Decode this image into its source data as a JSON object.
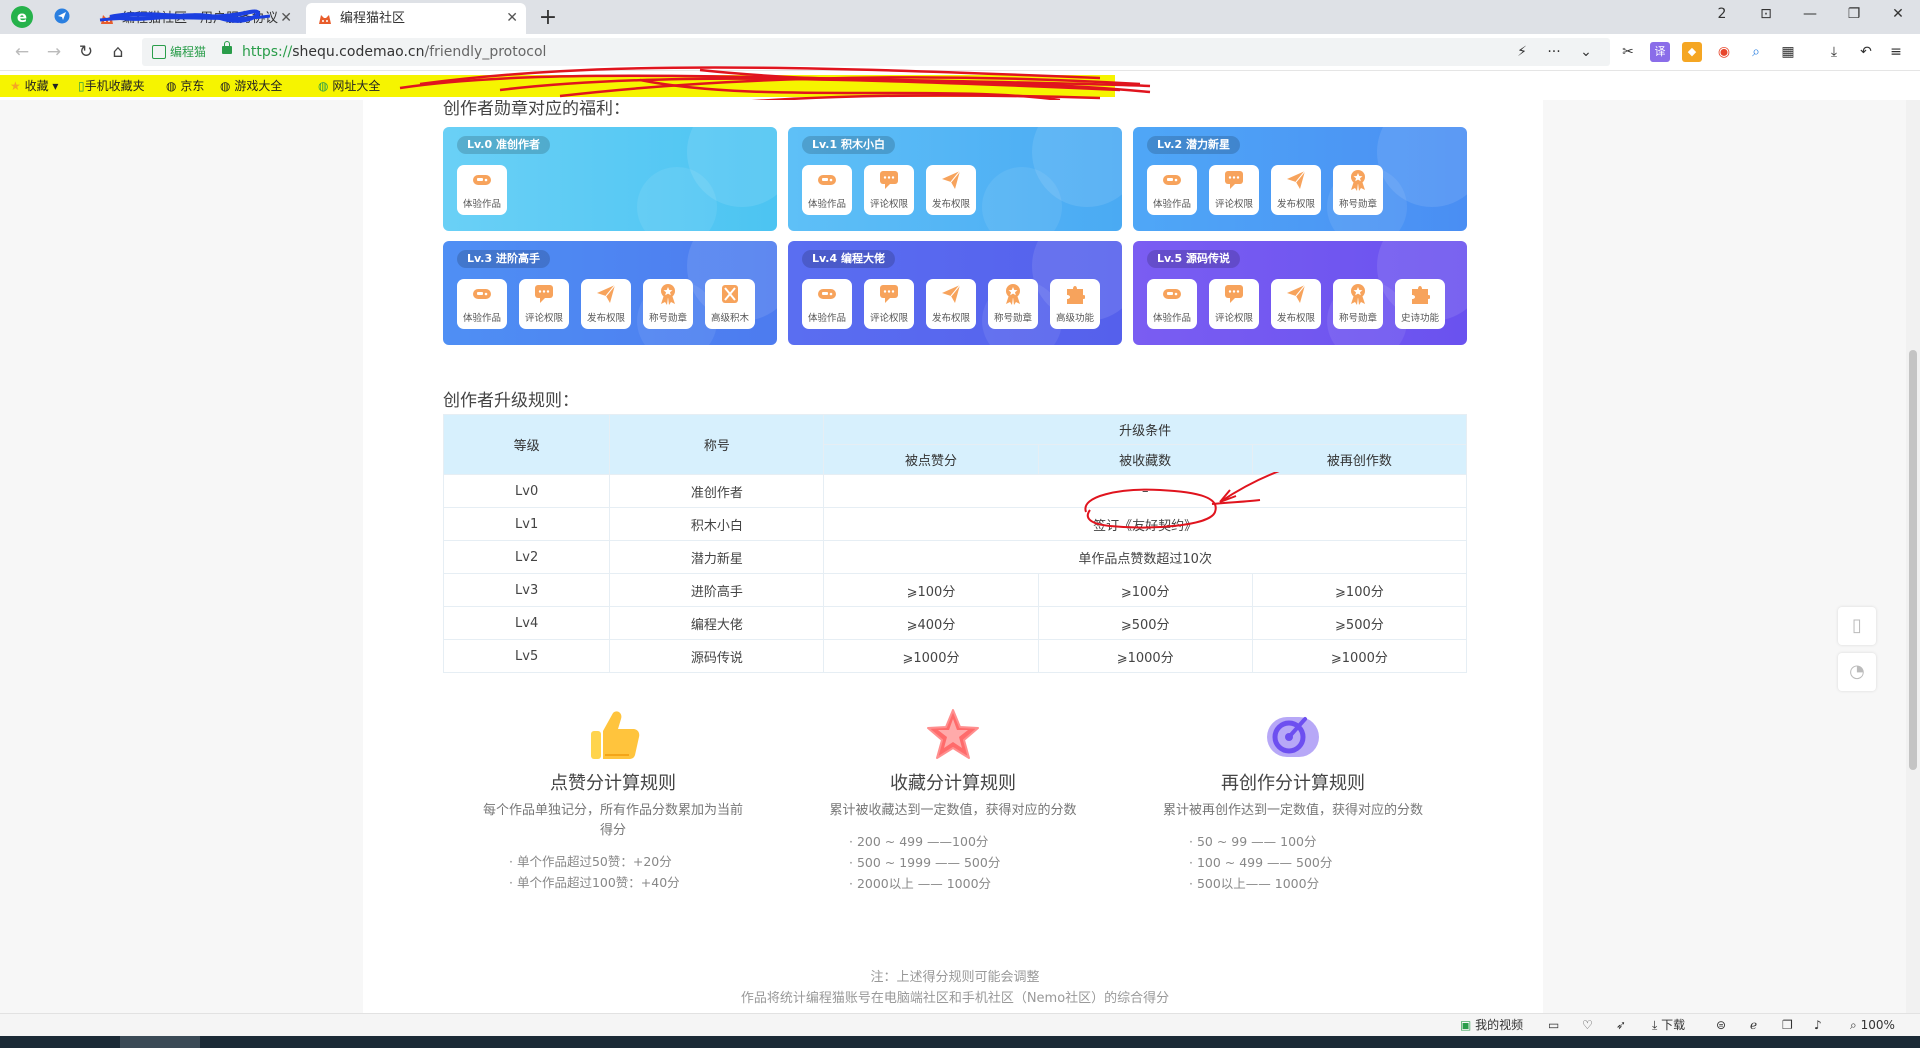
{
  "browser": {
    "tabs": [
      {
        "title": "编程猫社区 - 用户服务协议",
        "active": false
      },
      {
        "title": "编程猫社区",
        "active": true
      }
    ],
    "window_buttons": [
      "2",
      "⊡",
      "—",
      "❐",
      "✕"
    ],
    "address": {
      "site_badge": "编程猫",
      "url_protocol": "https://",
      "url_host": "shequ.codemao.cn",
      "url_path": "/friendly_protocol"
    },
    "bookmarks": [
      {
        "label": "收藏",
        "icon": "star-icon"
      },
      {
        "label": "手机收藏夹",
        "icon": "phone-icon"
      },
      {
        "label": "京东",
        "icon": "globe-icon"
      },
      {
        "label": "游戏大全",
        "icon": "globe-icon"
      },
      {
        "label": "网址大全",
        "icon": "globe-icon"
      }
    ]
  },
  "page": {
    "medal_section_title": "创作者勋章对应的福利：",
    "medal_cards": [
      {
        "level": "Lv.0",
        "name": "准创作者",
        "color_from": "#6ad0f6",
        "color_to": "#4cc4f2",
        "perms": [
          {
            "label": "体验作品",
            "icon": "gamepad-icon"
          }
        ]
      },
      {
        "level": "Lv.1",
        "name": "积木小白",
        "color_from": "#5ec0f7",
        "color_to": "#4aaaf3",
        "perms": [
          {
            "label": "体验作品",
            "icon": "gamepad-icon"
          },
          {
            "label": "评论权限",
            "icon": "comment-icon"
          },
          {
            "label": "发布权限",
            "icon": "paper-plane-icon"
          }
        ]
      },
      {
        "level": "Lv.2",
        "name": "潜力新星",
        "color_from": "#4fa7f7",
        "color_to": "#4a8ef3",
        "perms": [
          {
            "label": "体验作品",
            "icon": "gamepad-icon"
          },
          {
            "label": "评论权限",
            "icon": "comment-icon"
          },
          {
            "label": "发布权限",
            "icon": "paper-plane-icon"
          },
          {
            "label": "称号勋章",
            "icon": "medal-icon"
          }
        ]
      },
      {
        "level": "Lv.3",
        "name": "进阶高手",
        "color_from": "#4f8ff4",
        "color_to": "#4d7bef",
        "perms": [
          {
            "label": "体验作品",
            "icon": "gamepad-icon"
          },
          {
            "label": "评论权限",
            "icon": "comment-icon"
          },
          {
            "label": "发布权限",
            "icon": "paper-plane-icon"
          },
          {
            "label": "称号勋章",
            "icon": "medal-icon"
          },
          {
            "label": "高级积木",
            "icon": "tools-icon"
          }
        ]
      },
      {
        "level": "Lv.4",
        "name": "编程大佬",
        "color_from": "#5a6ef1",
        "color_to": "#5560ec",
        "perms": [
          {
            "label": "体验作品",
            "icon": "gamepad-icon"
          },
          {
            "label": "评论权限",
            "icon": "comment-icon"
          },
          {
            "label": "发布权限",
            "icon": "paper-plane-icon"
          },
          {
            "label": "称号勋章",
            "icon": "medal-icon"
          },
          {
            "label": "高级功能",
            "icon": "puzzle-icon"
          }
        ]
      },
      {
        "level": "Lv.5",
        "name": "源码传说",
        "color_from": "#7a5df2",
        "color_to": "#6a52ef",
        "perms": [
          {
            "label": "体验作品",
            "icon": "gamepad-icon"
          },
          {
            "label": "评论权限",
            "icon": "comment-icon"
          },
          {
            "label": "发布权限",
            "icon": "paper-plane-icon"
          },
          {
            "label": "称号勋章",
            "icon": "medal-icon"
          },
          {
            "label": "史诗功能",
            "icon": "puzzle-icon"
          }
        ]
      }
    ],
    "upgrade_section_title": "创作者升级规则：",
    "table": {
      "headers": {
        "level": "等级",
        "title": "称号",
        "conditions": "升级条件",
        "likes": "被点赞分",
        "favorites": "被收藏数",
        "remixes": "被再创作数"
      },
      "rows": [
        {
          "level": "Lv0",
          "title": "准创作者",
          "merged": "–"
        },
        {
          "level": "Lv1",
          "title": "积木小白",
          "merged": "签订《友好契约》"
        },
        {
          "level": "Lv2",
          "title": "潜力新星",
          "merged": "单作品点赞数超过10次"
        },
        {
          "level": "Lv3",
          "title": "进阶高手",
          "likes": "⩾100分",
          "favorites": "⩾100分",
          "remixes": "⩾100分"
        },
        {
          "level": "Lv4",
          "title": "编程大佬",
          "likes": "⩾400分",
          "favorites": "⩾500分",
          "remixes": "⩾500分"
        },
        {
          "level": "Lv5",
          "title": "源码传说",
          "likes": "⩾1000分",
          "favorites": "⩾1000分",
          "remixes": "⩾1000分"
        }
      ]
    },
    "rules": [
      {
        "title": "点赞分计算规则",
        "icon": "thumbs-up-icon",
        "desc": "每个作品单独记分，所有作品分数累加为当前得分",
        "items": [
          "· 单个作品超过50赞：+20分",
          "· 单个作品超过100赞：+40分"
        ]
      },
      {
        "title": "收藏分计算规则",
        "icon": "star-icon",
        "desc": "累计被收藏达到一定数值，获得对应的分数",
        "items": [
          "· 200 ~ 499 ——100分",
          "· 500 ~ 1999 —— 500分",
          "· 2000以上 —— 1000分"
        ]
      },
      {
        "title": "再创作分计算规则",
        "icon": "remix-icon",
        "desc": "累计被再创作达到一定数值，获得对应的分数",
        "items": [
          "· 50 ~ 99 —— 100分",
          "· 100 ~ 499 —— 500分",
          "· 500以上—— 1000分"
        ]
      }
    ],
    "note_1": "注：上述得分规则可能会调整",
    "note_2": "作品将统计编程猫账号在电脑端社区和手机社区（Nemo社区）的综合得分"
  },
  "statusbar": {
    "video_label": "我的视频",
    "download_label": "下载",
    "zoom": "100%"
  },
  "colors": {
    "accent": "#2a9d4a",
    "orange_icon": "#f7a35c",
    "table_header": "#d7f0fd",
    "annotation_red": "#e0141e"
  }
}
